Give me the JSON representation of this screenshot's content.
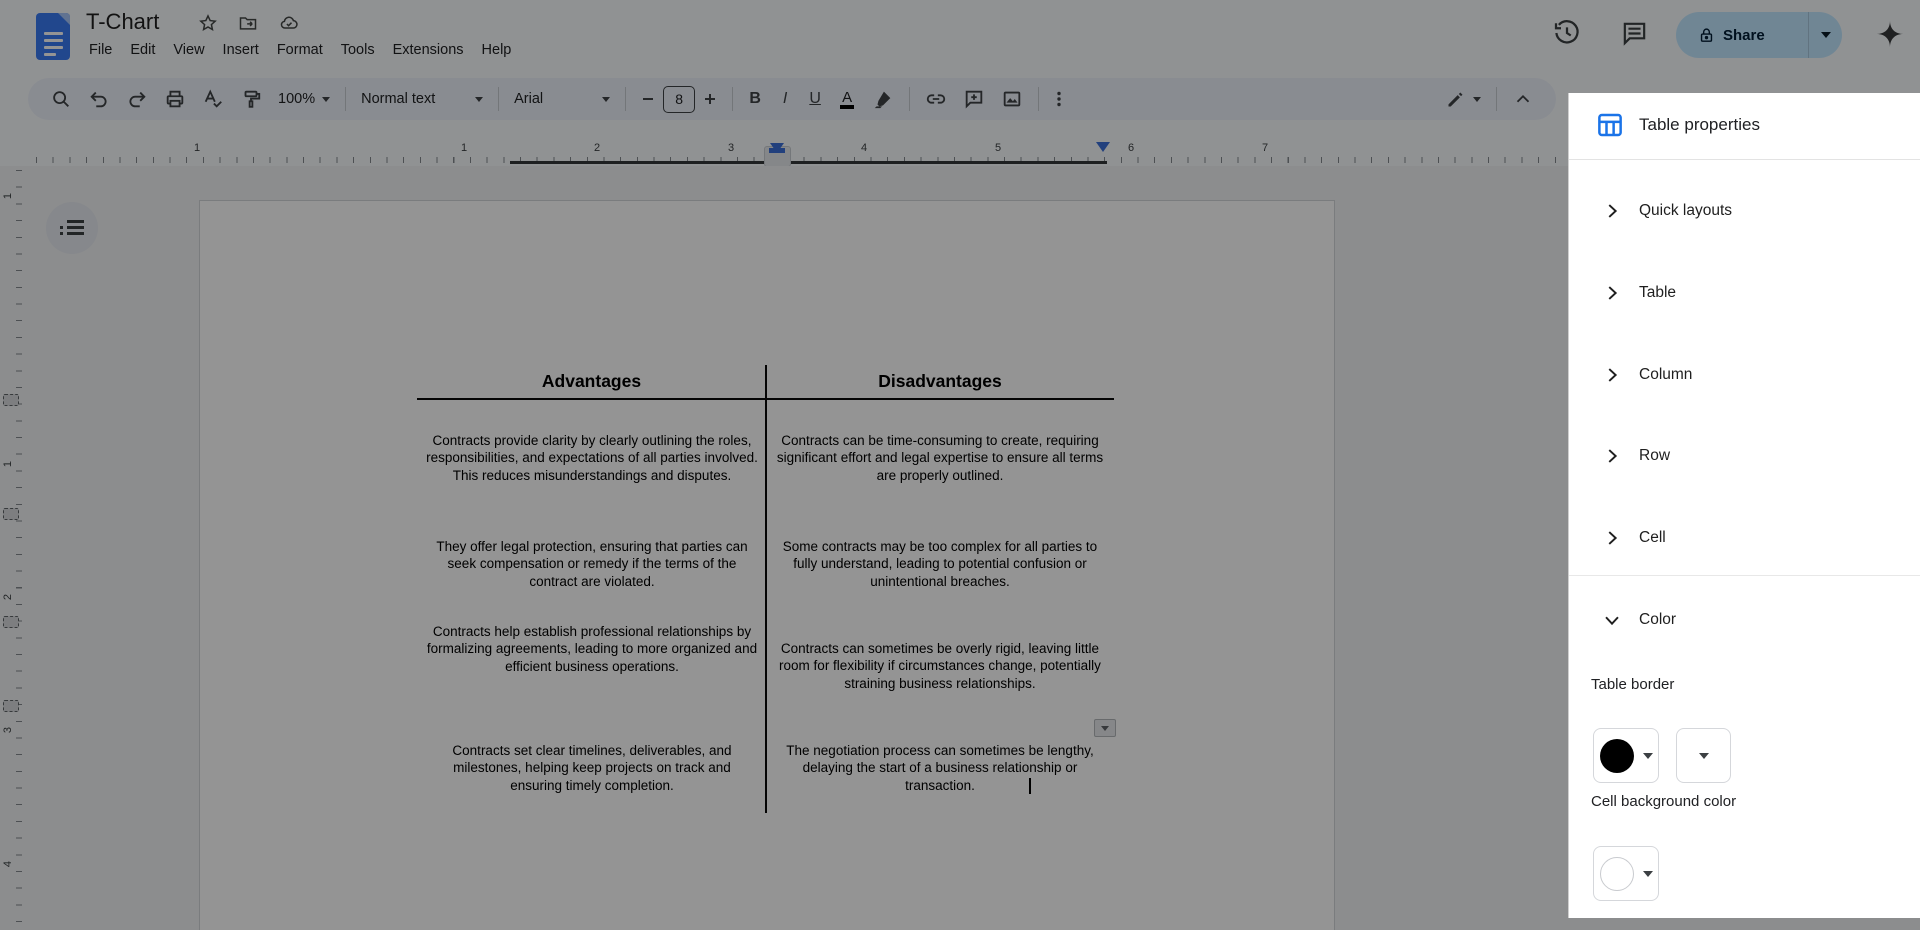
{
  "app": {
    "title": "T-Chart"
  },
  "menu": {
    "items": [
      {
        "label": "File"
      },
      {
        "label": "Edit"
      },
      {
        "label": "View"
      },
      {
        "label": "Insert"
      },
      {
        "label": "Format"
      },
      {
        "label": "Tools"
      },
      {
        "label": "Extensions"
      },
      {
        "label": "Help"
      }
    ]
  },
  "actions": {
    "share": "Share"
  },
  "toolbar": {
    "zoom": "100%",
    "paragraph_style": "Normal text",
    "font": "Arial",
    "font_size": "8",
    "bold": "B",
    "italic": "I",
    "underline": "U",
    "text_color": "A"
  },
  "ruler": {
    "horizontal_numbers": [
      "1",
      "1",
      "2",
      "3",
      "4",
      "5",
      "6",
      "7"
    ],
    "vertical_numbers": [
      "1",
      "1",
      "2",
      "3",
      "4"
    ]
  },
  "doc": {
    "table": {
      "headers": [
        {
          "label": "Advantages"
        },
        {
          "label": "Disadvantages"
        }
      ],
      "rows": [
        {
          "advantages": "Contracts provide clarity by clearly outlining the roles, responsibilities, and expectations of all parties involved. This reduces misunderstandings and disputes.",
          "disadvantages": "Contracts can be time-consuming to create, requiring significant effort and legal expertise to ensure all terms are properly outlined."
        },
        {
          "advantages": "They offer legal protection, ensuring that parties can seek compensation or remedy if the terms of the contract are violated.",
          "disadvantages": "Some contracts may be too complex for all parties to fully understand, leading to potential confusion or unintentional breaches."
        },
        {
          "advantages": "Contracts help establish professional relationships by formalizing agreements, leading to more organized and efficient business operations.",
          "disadvantages": "Contracts can sometimes be overly rigid, leaving little room for flexibility if circumstances change, potentially straining business relationships."
        },
        {
          "advantages": "Contracts set clear timelines, deliverables, and milestones, helping keep projects on track and ensuring timely completion.",
          "disadvantages": "The negotiation process can sometimes be lengthy, delaying the start of a business relationship or transaction."
        }
      ]
    }
  },
  "panel": {
    "title": "Table properties",
    "sections": [
      {
        "label": "Quick layouts"
      },
      {
        "label": "Table"
      },
      {
        "label": "Column"
      },
      {
        "label": "Row"
      },
      {
        "label": "Cell"
      },
      {
        "label": "Color"
      }
    ],
    "color_section": {
      "table_border_label": "Table border",
      "cell_background_label": "Cell background color",
      "border_color": "#000000",
      "cell_background_color": "#ffffff"
    }
  },
  "colors": {
    "accent_blue": "#1a73e8",
    "share_pill": "#c2e7ff",
    "toolbar_bg": "#edf2fa",
    "indent_marker": "#3b6fd8",
    "table_border": "#000000"
  },
  "icons": {
    "doc": "blue-document",
    "star": "star-outline",
    "move": "folder-arrow",
    "cloud": "cloud-check",
    "history": "clock-ccw",
    "comments": "speech-bubble",
    "lock": "padlock",
    "gemini": "four-point-sparkle",
    "search": "magnifier",
    "undo": "arrow-curl-left",
    "redo": "arrow-curl-right",
    "print": "printer",
    "spellcheck": "a-check",
    "paint": "paint-roller",
    "link": "chain",
    "add_comment": "bubble-plus",
    "image": "picture",
    "more": "three-dots",
    "edit_mode": "pencil",
    "collapse": "chevron-up",
    "outline": "bulleted-list",
    "table_properties": "table-grid"
  }
}
